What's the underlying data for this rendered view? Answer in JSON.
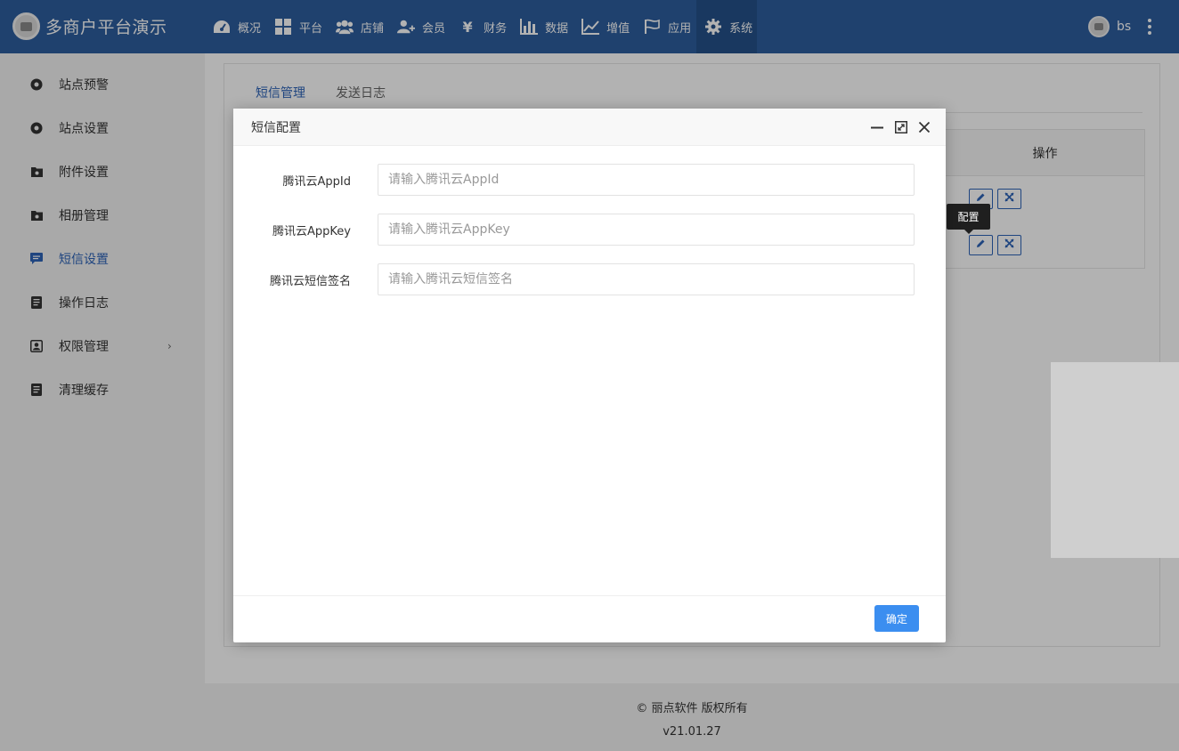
{
  "app": {
    "title": "多商户平台演示"
  },
  "nav": [
    {
      "label": "概况",
      "icon": "dashboard-icon"
    },
    {
      "label": "平台",
      "icon": "grid-icon"
    },
    {
      "label": "店铺",
      "icon": "users-icon"
    },
    {
      "label": "会员",
      "icon": "user-add-icon"
    },
    {
      "label": "财务",
      "icon": "yen-icon"
    },
    {
      "label": "数据",
      "icon": "bar-chart-icon"
    },
    {
      "label": "增值",
      "icon": "line-chart-icon"
    },
    {
      "label": "应用",
      "icon": "flag-icon"
    },
    {
      "label": "系统",
      "icon": "gear-icon",
      "active": true
    }
  ],
  "user": {
    "name": "bs"
  },
  "sidebar": {
    "items": [
      {
        "label": "站点预警",
        "icon": "circle-dot-icon"
      },
      {
        "label": "站点设置",
        "icon": "circle-dot-icon"
      },
      {
        "label": "附件设置",
        "icon": "folder-icon"
      },
      {
        "label": "相册管理",
        "icon": "folder-icon"
      },
      {
        "label": "短信设置",
        "icon": "message-icon",
        "active": true
      },
      {
        "label": "操作日志",
        "icon": "document-icon"
      },
      {
        "label": "权限管理",
        "icon": "person-card-icon"
      },
      {
        "label": "清理缓存",
        "icon": "document-icon"
      }
    ]
  },
  "tabs": [
    {
      "label": "短信管理",
      "active": true
    },
    {
      "label": "发送日志"
    }
  ],
  "table": {
    "header_operation": "操作"
  },
  "tooltip": {
    "text": "配置"
  },
  "modal": {
    "title": "短信配置",
    "fields": [
      {
        "label": "腾讯云AppId",
        "placeholder": "请输入腾讯云AppId",
        "value": ""
      },
      {
        "label": "腾讯云AppKey",
        "placeholder": "请输入腾讯云AppKey",
        "value": ""
      },
      {
        "label": "腾讯云短信签名",
        "placeholder": "请输入腾讯云短信签名",
        "value": ""
      }
    ],
    "confirm_label": "确定"
  },
  "footer": {
    "copyright": "© 丽点软件 版权所有",
    "version": "v21.01.27"
  },
  "colors": {
    "topbar": "#2d5d9e",
    "accent": "#2d63b8",
    "confirm_button": "#3b8ef0"
  }
}
